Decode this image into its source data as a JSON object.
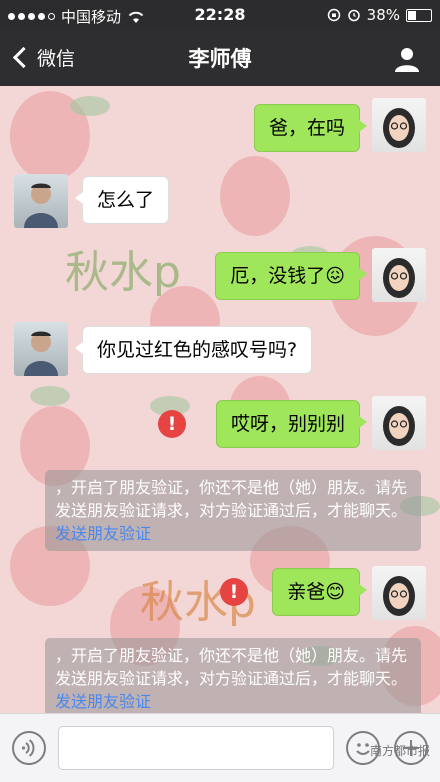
{
  "status_bar": {
    "carrier": "中国移动",
    "time": "22:28",
    "battery": "38%",
    "battery_level": 0.38
  },
  "nav": {
    "back_label": "微信",
    "title": "李师傅",
    "contact_icon": "person-icon"
  },
  "messages": [
    {
      "from": "me",
      "text": "爸，在吗"
    },
    {
      "from": "other",
      "text": "怎么了"
    },
    {
      "from": "me",
      "text": "厄，没钱了😖"
    },
    {
      "from": "other",
      "text": "你见过红色的感叹号吗?"
    },
    {
      "from": "me",
      "text": "哎呀，别别别",
      "failed": true
    },
    {
      "from": "system",
      "text": "，开启了朋友验证，你还不是他（她）朋友。请先发送朋友验证请求，对方验证通过后，才能聊天。",
      "link": "发送朋友验证"
    },
    {
      "from": "me",
      "text": "亲爸😊",
      "failed": true
    },
    {
      "from": "system",
      "text": "，开启了朋友验证，你还不是他（她）朋友。请先发送朋友验证请求，对方验证通过后，才能聊天。",
      "link": "发送朋友验证"
    }
  ],
  "error_glyph": "!",
  "wallpaper_text": [
    "秋水p",
    "秋水p"
  ],
  "input_bar": {
    "voice_icon": "voice-icon",
    "emoji_icon": "emoji-icon",
    "plus_icon": "plus-icon"
  },
  "watermark": "南方都市报",
  "colors": {
    "my_bubble": "#9fe65b",
    "error": "#e64343",
    "link": "#4a87ee"
  }
}
